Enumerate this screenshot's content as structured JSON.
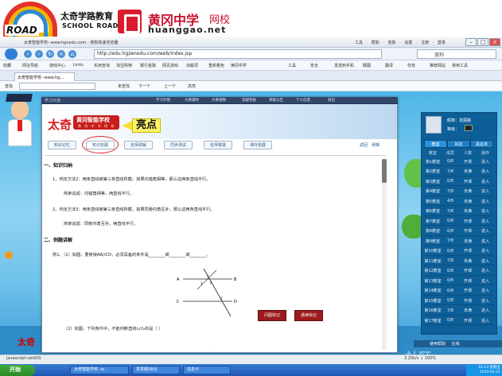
{
  "banner": {
    "road_word": "ROAD",
    "school_cn": "太奇学路教育",
    "school_en": "SCHOOL ROAD",
    "huanggang_cn": "黄冈中学",
    "huanggang_cn2": "网校",
    "huanggang_en": "huanggao.net"
  },
  "browser": {
    "window_title": "太奇智能学校--www.hgnedu.com - 搜狗高速浏览器",
    "menus": "工具 · 帮助 · 皮肤 · 设置 · 注册 · 登录",
    "address": "http://edu.hgzenedu.com/web/index.jsp",
    "search_text": "搜狗",
    "favorites": [
      "收藏",
      "网址导航",
      "游戏中心",
      "Links",
      "实用查询",
      "淘宝购物",
      "银行金融",
      "网页游戏",
      "加载项",
      "重新着色",
      "黄冈中学",
      "工具",
      "安全",
      "发送到手机",
      "截图",
      "翻译",
      "夸克",
      "推荐网站",
      "常用工具"
    ],
    "tab_label": "太奇智能学校--www.hg...",
    "find_labels": [
      "查找",
      "未查找",
      "下一个",
      "上一个",
      "高亮"
    ],
    "status": "javascript:void(0)",
    "status_right": "3.25k/s  ↓  100%"
  },
  "app": {
    "small_title": "学习计划",
    "topnav": [
      "学习计划",
      "大奇辅导",
      "大奇视频",
      "答疑奖励",
      "系统公告",
      "个人信息",
      "退出"
    ],
    "brand_main": "太奇",
    "brand_school": "黄冈智能学校",
    "brand_sub": "黄 冈 中 学 网 校",
    "callout": "亮点",
    "tabs": [
      "知识记忆",
      "知识拓展",
      "名师讲解",
      "同步测试",
      "名师答疑",
      "课外拓展"
    ],
    "tab_right": "返回  刷新",
    "section1": "一、知识归纳",
    "line1": "1、判定方法2：两条直线被第三条直线所截，如果内错角相等，那么这两条直线平行。",
    "line1b": "简单说成：内错角相等，两直线平行。",
    "line2": "2、判定方法3：两条直线被第三条直线所截，如果同旁内角互补，那么这两条直线平行。",
    "line2b": "简单说成：同旁内角互补，两直线平行。",
    "section2": "二、例题讲解",
    "example1": "例1、（1）如图，要使得AB//CD，必须具备的条件是________或________或________。",
    "example2": "（2）如图，下列条件中，不能判断直线l₁//l₂的是（   ）",
    "btn_flash": "闪图快记",
    "btn_read": "通读快记",
    "footer_dot": "·",
    "diagram_labels": [
      "A",
      "B",
      "C",
      "D",
      "1",
      "2",
      "3",
      "4"
    ]
  },
  "right_panel": {
    "user": "昵称：发展路",
    "grade": "等级：",
    "tabs": [
      "教室",
      "好友",
      "黑名单"
    ],
    "headers": [
      "教室",
      "成员",
      "人数",
      "操作"
    ],
    "rows": [
      [
        "第1教室",
        "0/8",
        "开课",
        "进入"
      ],
      [
        "第2教室",
        "7/8",
        "未满",
        "进入"
      ],
      [
        "第3教室",
        "0/8",
        "开课",
        "进入"
      ],
      [
        "第4教室",
        "7/8",
        "未满",
        "进入"
      ],
      [
        "第5教室",
        "4/8",
        "未满",
        "进入"
      ],
      [
        "第6教室",
        "7/8",
        "未满",
        "进入"
      ],
      [
        "第7教室",
        "0/8",
        "开课",
        "进入"
      ],
      [
        "第8教室",
        "0/8",
        "开课",
        "进入"
      ],
      [
        "第9教室",
        "7/8",
        "未满",
        "进入"
      ],
      [
        "第10教室",
        "0/8",
        "开课",
        "进入"
      ],
      [
        "第11教室",
        "7/8",
        "未满",
        "进入"
      ],
      [
        "第12教室",
        "0/8",
        "开课",
        "进入"
      ],
      [
        "第13教室",
        "0/8",
        "开课",
        "进入"
      ],
      [
        "第14教室",
        "0/8",
        "开课",
        "进入"
      ],
      [
        "第15教室",
        "0/8",
        "开课",
        "进入"
      ],
      [
        "第16教室",
        "7/8",
        "未满",
        "进入"
      ],
      [
        "第17教室",
        "0/8",
        "开课",
        "进入"
      ]
    ]
  },
  "footer": {
    "tai": "太奇",
    "help": "使用帮助  在线",
    "watermark": "社区"
  },
  "taskbar": {
    "start": "开始",
    "items": [
      "太奇智能学校--w...",
      "发票题I目合",
      "信息卡"
    ],
    "tray": "14:13 星期五 2014-03-21"
  }
}
